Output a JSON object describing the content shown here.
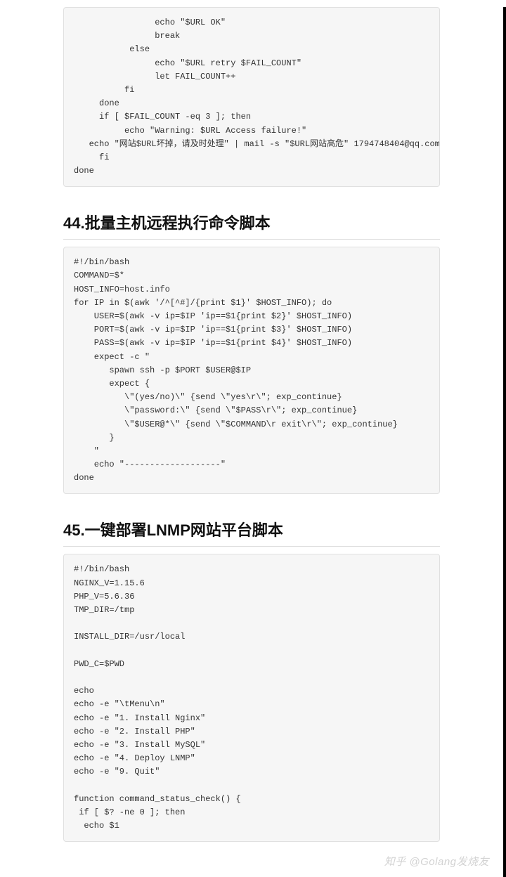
{
  "block1": "                echo \"$URL OK\"\n                break\n           else\n                echo \"$URL retry $FAIL_COUNT\"\n                let FAIL_COUNT++\n          fi\n     done\n     if [ $FAIL_COUNT -eq 3 ]; then\n          echo \"Warning: $URL Access failure!\"\n   echo \"网站$URL坏掉，请及时处理\" | mail -s \"$URL网站高危\" 1794748404@qq.com \n     fi\ndone",
  "heading44": "44.批量主机远程执行命令脚本",
  "block2": "#!/bin/bash\nCOMMAND=$*\nHOST_INFO=host.info\nfor IP in $(awk '/^[^#]/{print $1}' $HOST_INFO); do\n    USER=$(awk -v ip=$IP 'ip==$1{print $2}' $HOST_INFO)\n    PORT=$(awk -v ip=$IP 'ip==$1{print $3}' $HOST_INFO)\n    PASS=$(awk -v ip=$IP 'ip==$1{print $4}' $HOST_INFO)\n    expect -c \"\n       spawn ssh -p $PORT $USER@$IP\n       expect {\n          \\\"(yes/no)\\\" {send \\\"yes\\r\\\"; exp_continue}\n          \\\"password:\\\" {send \\\"$PASS\\r\\\"; exp_continue}\n          \\\"$USER@*\\\" {send \\\"$COMMAND\\r exit\\r\\\"; exp_continue}\n       }\n    \"\n    echo \"-------------------\"\ndone",
  "heading45": "45.一键部署LNMP网站平台脚本",
  "block3": "#!/bin/bash\nNGINX_V=1.15.6\nPHP_V=5.6.36\nTMP_DIR=/tmp\n\nINSTALL_DIR=/usr/local\n\nPWD_C=$PWD\n\necho\necho -e \"\\tMenu\\n\"\necho -e \"1. Install Nginx\"\necho -e \"2. Install PHP\"\necho -e \"3. Install MySQL\"\necho -e \"4. Deploy LNMP\"\necho -e \"9. Quit\"\n\nfunction command_status_check() {\n if [ $? -ne 0 ]; then\n  echo $1\n",
  "watermark": "知乎 @Golang发烧友"
}
